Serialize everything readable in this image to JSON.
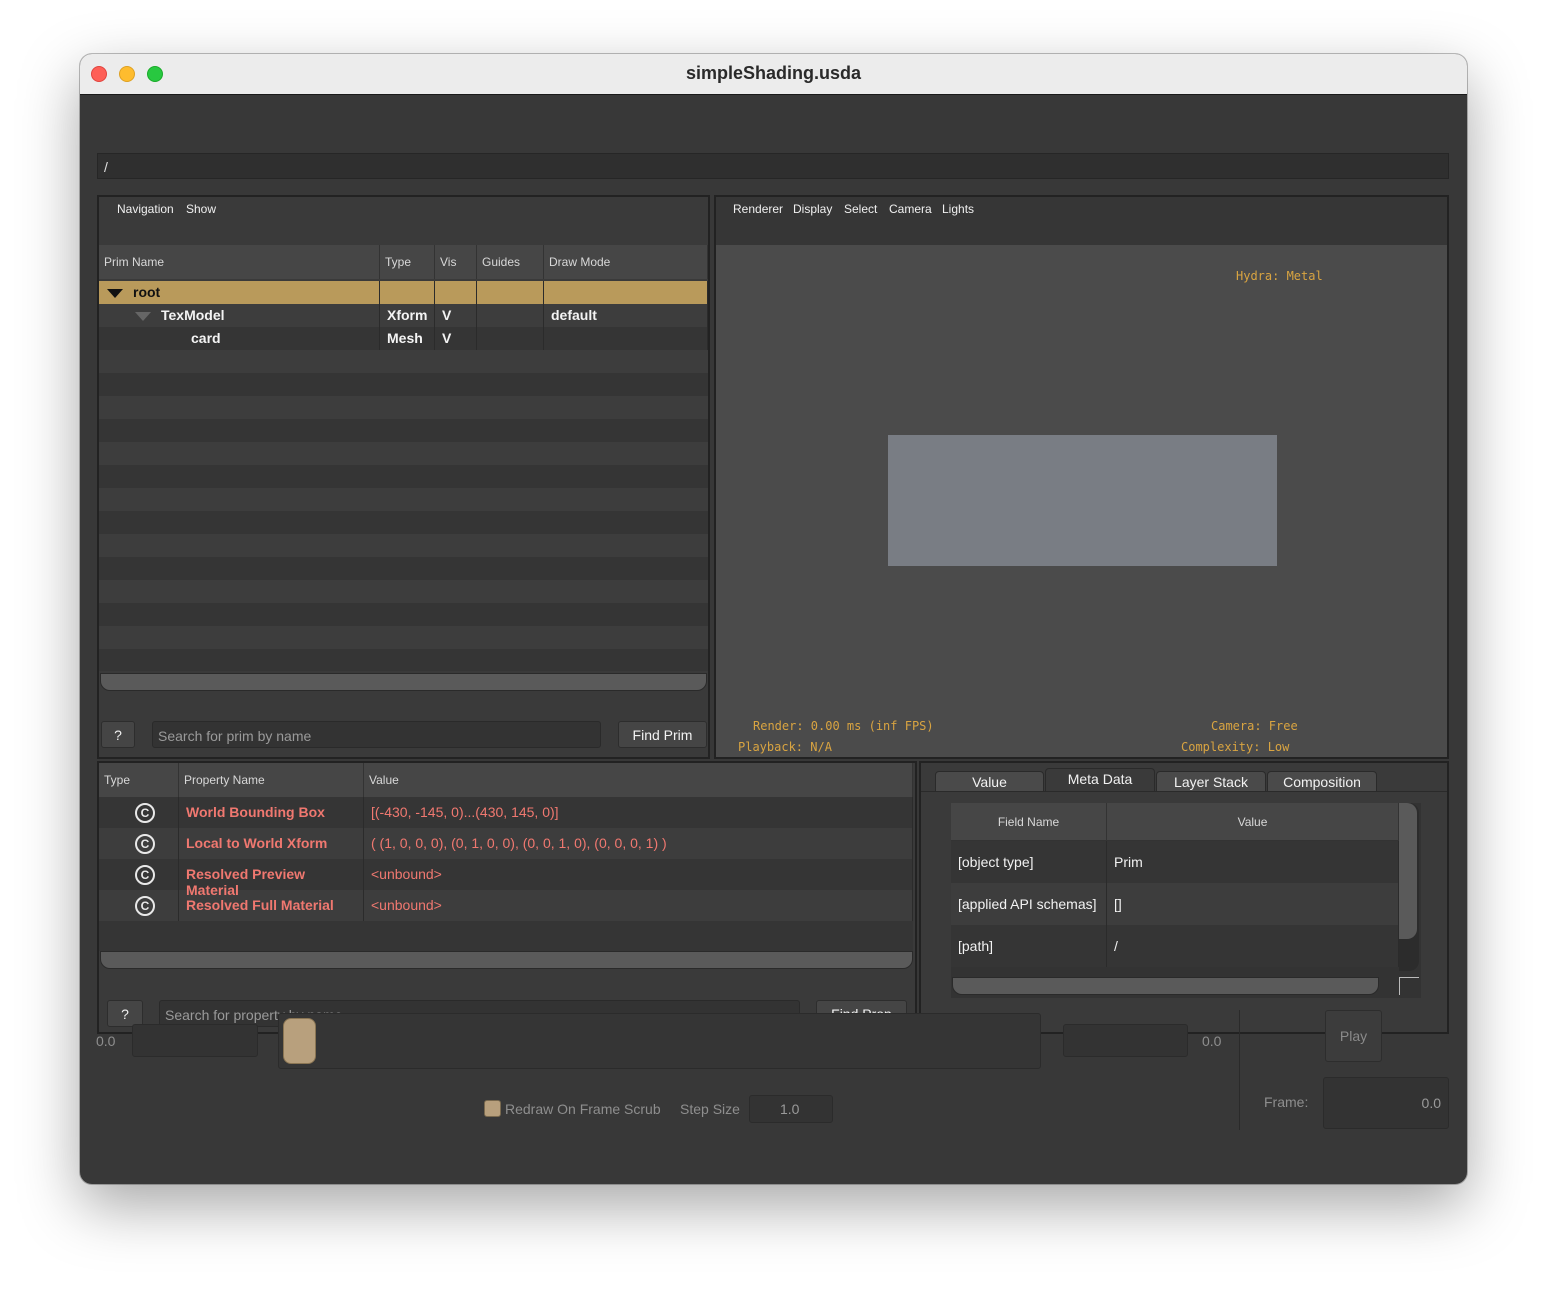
{
  "window": {
    "title": "simpleShading.usda"
  },
  "path_bar": {
    "value": "/"
  },
  "prim_browser": {
    "menu": [
      "Navigation",
      "Show"
    ],
    "columns": [
      "Prim Name",
      "Type",
      "Vis",
      "Guides",
      "Draw Mode"
    ],
    "rows": [
      {
        "name": "root",
        "type": "",
        "vis": "",
        "guides": "",
        "draw_mode": "",
        "selected": true
      },
      {
        "name": "TexModel",
        "type": "Xform",
        "vis": "V",
        "guides": "",
        "draw_mode": "default",
        "selected": false
      },
      {
        "name": "card",
        "type": "Mesh",
        "vis": "V",
        "guides": "",
        "draw_mode": "",
        "selected": false
      }
    ],
    "help_label": "?",
    "search_placeholder": "Search for prim by name",
    "find_label": "Find Prim"
  },
  "viewport": {
    "menu": [
      "Renderer",
      "Display",
      "Select",
      "Camera",
      "Lights"
    ],
    "hydra": "Hydra: Metal",
    "render": "Render: 0.00 ms (inf FPS)",
    "playback": "Playback: N/A",
    "camera": "Camera: Free",
    "complexity": "Complexity: Low"
  },
  "properties": {
    "columns": [
      "Type",
      "Property Name",
      "Value"
    ],
    "rows": [
      {
        "icon": "C",
        "name": "World Bounding Box",
        "value": "[(-430, -145, 0)...(430, 145, 0)]"
      },
      {
        "icon": "C",
        "name": "Local to World Xform",
        "value": "( (1, 0, 0, 0), (0, 1, 0, 0), (0, 0, 1, 0), (0, 0, 0, 1) )"
      },
      {
        "icon": "C",
        "name": "Resolved Preview Material",
        "value": "<unbound>"
      },
      {
        "icon": "C",
        "name": "Resolved Full Material",
        "value": "<unbound>"
      }
    ],
    "help_label": "?",
    "search_placeholder": "Search for property by name",
    "find_label": "Find Prop"
  },
  "metadata": {
    "tabs": [
      "Value",
      "Meta Data",
      "Layer Stack",
      "Composition"
    ],
    "active_tab": "Meta Data",
    "columns": [
      "Field Name",
      "Value"
    ],
    "rows": [
      {
        "field": "[object type]",
        "value": "Prim"
      },
      {
        "field": "[applied API schemas]",
        "value": "[]"
      },
      {
        "field": "[path]",
        "value": "/"
      }
    ]
  },
  "timeline": {
    "start_value": "0.0",
    "end_value": "0.0",
    "play_label": "Play",
    "redraw_label": "Redraw On Frame Scrub",
    "step_size_label": "Step Size",
    "step_size_value": "1.0",
    "frame_label": "Frame:",
    "frame_value": "0.0"
  },
  "colors": {
    "selection": "#b99a5b",
    "property_text": "#f07870",
    "hud_text": "#d9a441",
    "slider_thumb": "#b8a07d"
  }
}
